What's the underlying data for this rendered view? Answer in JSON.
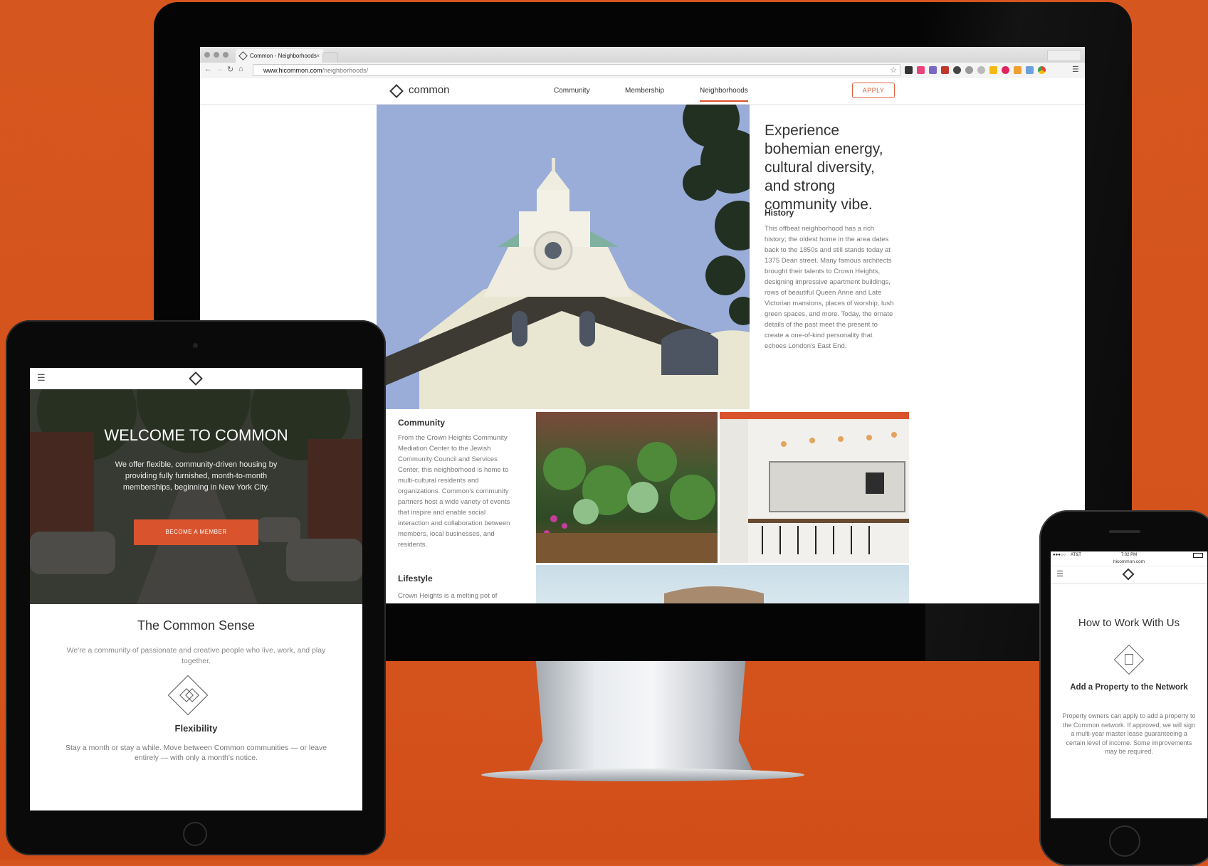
{
  "desktop": {
    "browser": {
      "tab_title": "Common - Neighborhoods",
      "tab_close": "×",
      "url_host": "www.hicommon.com",
      "url_path": "/neighborhoods/"
    },
    "site": {
      "logo_text": "common",
      "nav": [
        "Community",
        "Membership",
        "Neighborhoods"
      ],
      "active_nav": "Neighborhoods",
      "apply_label": "APPLY"
    },
    "content": {
      "headline": "Experience bohemian energy, cultural diversity, and strong community vibe.",
      "history_title": "History",
      "history_body": "This offbeat neighborhood has a rich history; the oldest home in the area dates back to the 1850s and still stands today at 1375 Dean street. Many famous architects brought their talents to Crown Heights, designing impressive apartment buildings, rows of beautiful Queen Anne and Late Victorian mansions, places of worship, lush green spaces, and more. Today, the ornate details of the past meet the present to create a one-of-kind personality that echoes London's East End.",
      "community_title": "Community",
      "community_body": "From the Crown Heights Community Mediation Center to the Jewish Community Council and Services Center, this neighborhood is home to multi-cultural residents and organizations. Common's community partners host a wide variety of events that inspire and enable social interaction and collaboration between members, local businesses, and residents.",
      "lifestyle_title": "Lifestyle",
      "lifestyle_body": "Crown Heights is a melting pot of"
    }
  },
  "tablet": {
    "hero_title": "WELCOME TO COMMON",
    "hero_body": "We offer flexible, community-driven housing by providing fully furnished, month-to-month memberships, beginning in New York City.",
    "hero_button": "BECOME A MEMBER",
    "section_title": "The Common Sense",
    "section_body": "We're a community of passionate and creative people who live, work, and play together.",
    "feature_title": "Flexibility",
    "feature_body": "Stay a month or stay a while. Move between Common communities — or leave entirely — with only a month's notice."
  },
  "phone": {
    "carrier": "AT&T",
    "time": "7:02 PM",
    "url": "hicommon.com",
    "section_title": "How to Work With Us",
    "feature_title": "Add a Property to the Network",
    "feature_body": "Property owners can apply to add a property to the Common network. If approved, we will sign a multi-year master lease guaranteeing a certain level of income. Some improvements may be required."
  },
  "colors": {
    "background": "#d6561f",
    "accent": "#d9532c"
  }
}
